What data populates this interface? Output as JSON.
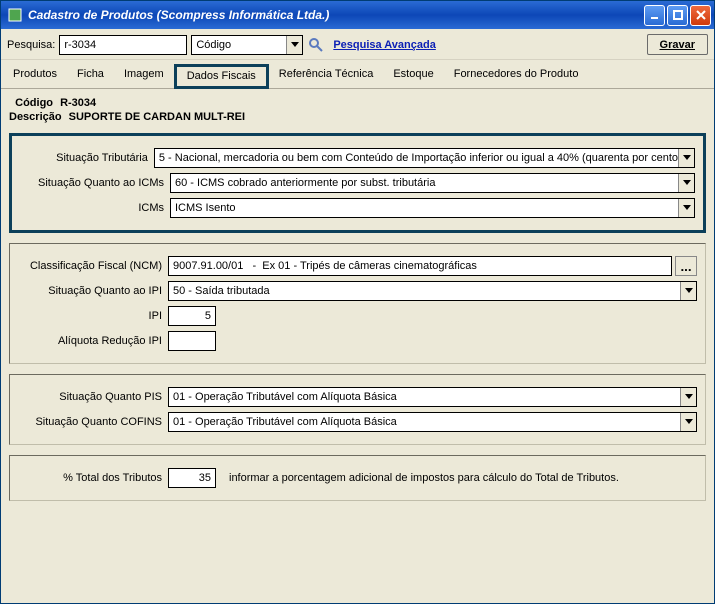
{
  "titlebar": {
    "title": "Cadastro de Produtos (Scompress Informática Ltda.)"
  },
  "search": {
    "label": "Pesquisa:",
    "value": "r-3034",
    "type_value": "Código",
    "advanced_link": "Pesquisa Avançada",
    "save_button": "Gravar"
  },
  "tabs": {
    "items": [
      "Produtos",
      "Ficha",
      "Imagem",
      "Dados Fiscais",
      "Referência Técnica",
      "Estoque",
      "Fornecedores do Produto"
    ],
    "active_index": 3
  },
  "header": {
    "codigo_label": "Código",
    "codigo_value": "R-3034",
    "descricao_label": "Descrição",
    "descricao_value": "SUPORTE DE CARDAN MULT-REI"
  },
  "icms_panel": {
    "sit_trib_label": "Situação Tributária",
    "sit_trib_value": "5 - Nacional, mercadoria ou bem com Conteúdo de Importação inferior ou igual a 40% (quarenta por cento",
    "sit_icms_label": "Situação Quanto ao ICMs",
    "sit_icms_value": "60 - ICMS cobrado anteriormente por subst. tributária",
    "icms_label": "ICMs",
    "icms_value": "ICMS Isento"
  },
  "ipi_panel": {
    "ncm_label": "Classificação Fiscal (NCM)",
    "ncm_value": "9007.91.00/01   -  Ex 01 - Tripés de câmeras cinematográficas",
    "lookup_label": "...",
    "sit_ipi_label": "Situação Quanto ao IPI",
    "sit_ipi_value": "50 - Saída tributada",
    "ipi_label": "IPI",
    "ipi_value": "5",
    "aliq_red_label": "Alíquota Redução IPI",
    "aliq_red_value": ""
  },
  "pis_panel": {
    "sit_pis_label": "Situação Quanto PIS",
    "sit_pis_value": "01 - Operação Tributável com Alíquota Básica",
    "sit_cofins_label": "Situação Quanto COFINS",
    "sit_cofins_value": "01 - Operação Tributável com Alíquota Básica"
  },
  "tributos_panel": {
    "pct_label": "% Total dos Tributos",
    "pct_value": "35",
    "hint": "informar a porcentagem adicional de impostos para cálculo do Total de Tributos."
  }
}
